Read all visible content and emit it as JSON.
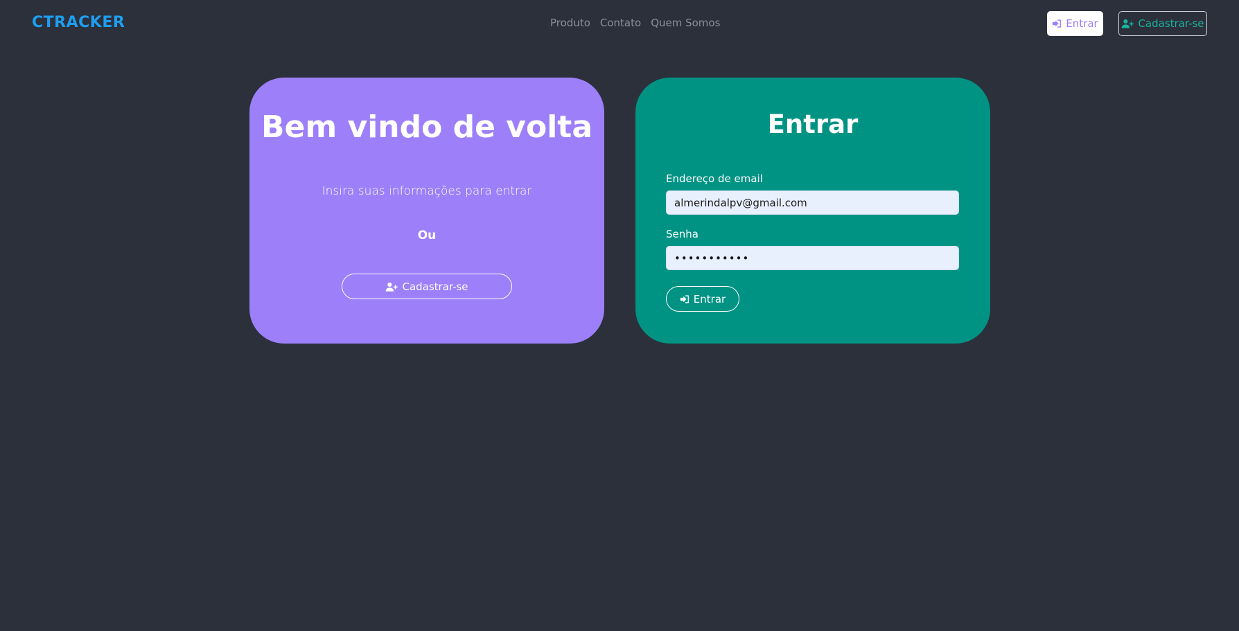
{
  "navbar": {
    "brand": "CTRACKER",
    "links": [
      "Produto",
      "Contato",
      "Quem Somos"
    ],
    "login_label": "Entrar",
    "signup_label": "Cadastrar-se"
  },
  "welcome_card": {
    "title": "Bem vindo de volta",
    "subtitle": "Insira suas informações para entrar",
    "or_text": "Ou",
    "signup_label": "Cadastrar-se"
  },
  "login_card": {
    "title": "Entrar",
    "email_label": "Endereço de email",
    "email_value": "almerindalpv@gmail.com",
    "password_label": "Senha",
    "password_value": "•••••••••••",
    "submit_label": "Entrar"
  },
  "colors": {
    "background": "#2b303b",
    "brand": "#1f9ef0",
    "welcome_card": "#9d7ff9",
    "login_card": "#009384"
  },
  "icons": {
    "login": "sign-in-icon",
    "signup": "user-plus-icon"
  }
}
